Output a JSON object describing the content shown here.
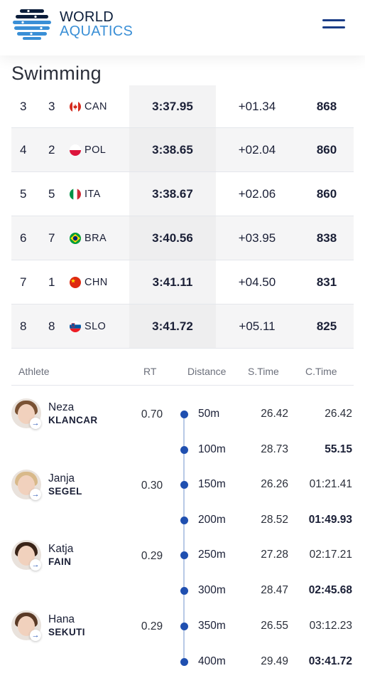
{
  "header": {
    "logo_line1": "WORLD",
    "logo_line2": "AQUATICS",
    "brand_color": "#3a8fd6",
    "menu_icon": "hamburger-icon"
  },
  "page": {
    "title": "Swimming"
  },
  "results": [
    {
      "rank": "3",
      "lane": "3",
      "country": "CAN",
      "flag": "canada-flag",
      "time": "3:37.95",
      "behind": "+01.34",
      "points": "868"
    },
    {
      "rank": "4",
      "lane": "2",
      "country": "POL",
      "flag": "poland-flag",
      "time": "3:38.65",
      "behind": "+02.04",
      "points": "860"
    },
    {
      "rank": "5",
      "lane": "5",
      "country": "ITA",
      "flag": "italy-flag",
      "time": "3:38.67",
      "behind": "+02.06",
      "points": "860"
    },
    {
      "rank": "6",
      "lane": "7",
      "country": "BRA",
      "flag": "brazil-flag",
      "time": "3:40.56",
      "behind": "+03.95",
      "points": "838"
    },
    {
      "rank": "7",
      "lane": "1",
      "country": "CHN",
      "flag": "china-flag",
      "time": "3:41.11",
      "behind": "+04.50",
      "points": "831"
    },
    {
      "rank": "8",
      "lane": "8",
      "country": "SLO",
      "flag": "slovenia-flag",
      "time": "3:41.72",
      "behind": "+05.11",
      "points": "825"
    }
  ],
  "splits_header": {
    "athlete": "Athlete",
    "rt": "RT",
    "distance": "Distance",
    "stime": "S.Time",
    "ctime": "C.Time"
  },
  "athletes": [
    {
      "first": "Neza",
      "last": "KLANCAR",
      "rt": "0.70"
    },
    {
      "first": "Janja",
      "last": "SEGEL",
      "rt": "0.30"
    },
    {
      "first": "Katja",
      "last": "FAIN",
      "rt": "0.29"
    },
    {
      "first": "Hana",
      "last": "SEKUTI",
      "rt": "0.29"
    }
  ],
  "splits": [
    {
      "distance": "50m",
      "stime": "26.42",
      "ctime": "26.42",
      "bold": false
    },
    {
      "distance": "100m",
      "stime": "28.73",
      "ctime": "55.15",
      "bold": true
    },
    {
      "distance": "150m",
      "stime": "26.26",
      "ctime": "01:21.41",
      "bold": false
    },
    {
      "distance": "200m",
      "stime": "28.52",
      "ctime": "01:49.93",
      "bold": true
    },
    {
      "distance": "250m",
      "stime": "27.28",
      "ctime": "02:17.21",
      "bold": false
    },
    {
      "distance": "300m",
      "stime": "28.47",
      "ctime": "02:45.68",
      "bold": true
    },
    {
      "distance": "350m",
      "stime": "26.55",
      "ctime": "03:12.23",
      "bold": false
    },
    {
      "distance": "400m",
      "stime": "29.49",
      "ctime": "03:41.72",
      "bold": true
    }
  ]
}
